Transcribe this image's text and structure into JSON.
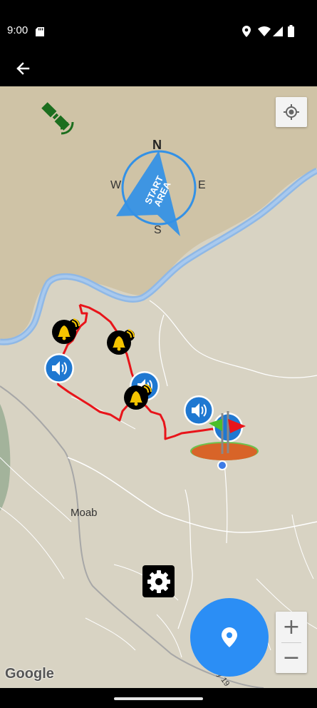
{
  "status_bar": {
    "time": "9:00",
    "icons": [
      "sd-card-icon",
      "location-icon",
      "wifi-icon",
      "signal-icon",
      "battery-icon"
    ]
  },
  "app_bar": {
    "back_icon": "arrow-back-icon"
  },
  "map": {
    "place_label": "Moab",
    "road_label": "y 19",
    "attribution": "Google"
  },
  "compass": {
    "north": "N",
    "south": "S",
    "east": "E",
    "west": "W",
    "area_label_line1": "START",
    "area_label_line2": "AREA"
  },
  "controls": {
    "zoom_in": "+",
    "zoom_out": "−",
    "locate_icon": "my-location-icon",
    "settings_icon": "gear-icon",
    "fab_icon": "location-pin-icon",
    "gps_icon": "satellite-icon"
  },
  "markers": {
    "bell_count": 3,
    "audio_count": 4,
    "flag_count": 2
  },
  "colors": {
    "route": "#e8141a",
    "river": "#8fb8e6",
    "fab": "#2b8ef5",
    "compass": "#3391e6",
    "gps": "#1c6e1e",
    "bell_bg": "#000000",
    "bell": "#f5c400",
    "audio": "#1f78d1"
  }
}
